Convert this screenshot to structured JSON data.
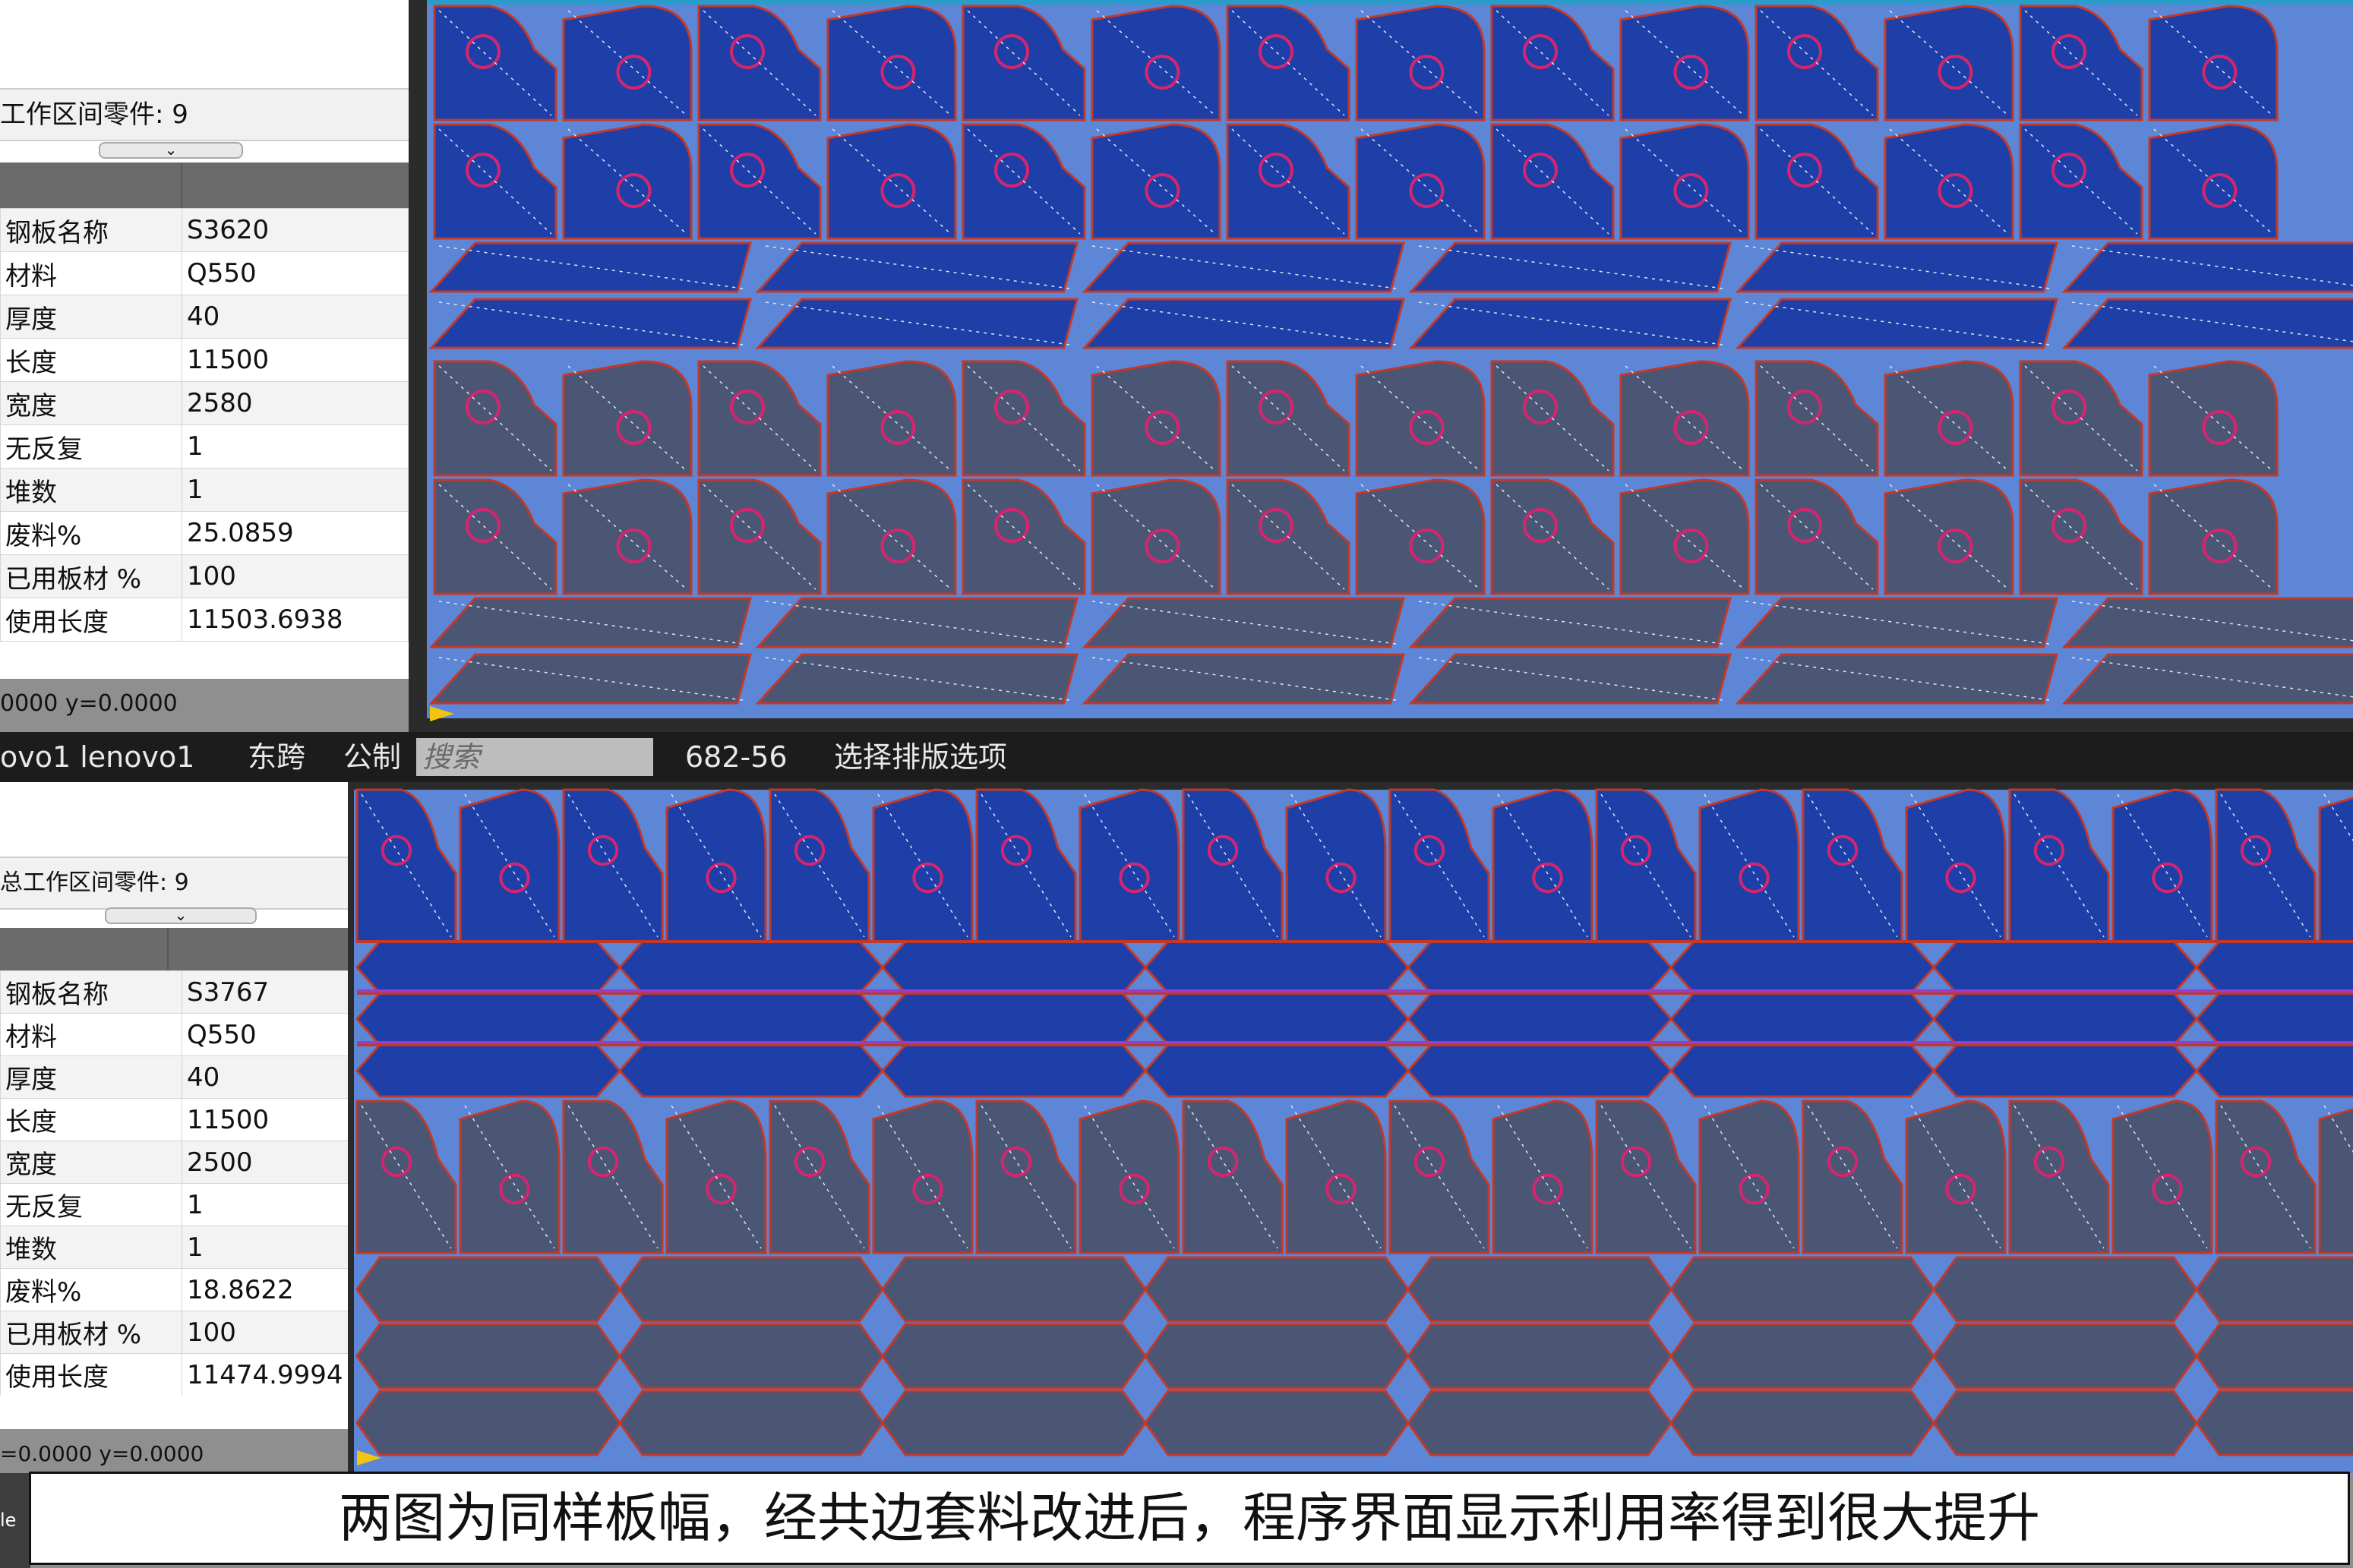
{
  "top": {
    "count_label": "工作区间零件: 9",
    "rows": [
      {
        "k": "钢板名称",
        "v": "S3620"
      },
      {
        "k": "材料",
        "v": "Q550"
      },
      {
        "k": "厚度",
        "v": "40"
      },
      {
        "k": "长度",
        "v": "11500"
      },
      {
        "k": "宽度",
        "v": "2580"
      },
      {
        "k": "无反复",
        "v": "1"
      },
      {
        "k": "堆数",
        "v": "1"
      },
      {
        "k": "废料%",
        "v": "25.0859"
      },
      {
        "k": "已用板材 %",
        "v": "100"
      },
      {
        "k": "使用长度",
        "v": "11503.6938"
      }
    ],
    "coords": "0000 y=0.0000"
  },
  "status": {
    "user": "ovo1 lenovo1",
    "timezone": "东跨",
    "units": "公制",
    "search_placeholder": "搜索",
    "code": "682-56",
    "nest_option": "选择排版选项"
  },
  "bottom": {
    "count_label": "总工作区间零件: 9",
    "rows": [
      {
        "k": "钢板名称",
        "v": "S3767"
      },
      {
        "k": "材料",
        "v": "Q550"
      },
      {
        "k": "厚度",
        "v": "40"
      },
      {
        "k": "长度",
        "v": "11500"
      },
      {
        "k": "宽度",
        "v": "2500"
      },
      {
        "k": "无反复",
        "v": "1"
      },
      {
        "k": "堆数",
        "v": "1"
      },
      {
        "k": "废料%",
        "v": "18.8622"
      },
      {
        "k": "已用板材 %",
        "v": "100"
      },
      {
        "k": "使用长度",
        "v": "11474.9994"
      }
    ],
    "coords": "=0.0000 y=0.0000",
    "taskbar_text": "le"
  },
  "caption": "两图为同样板幅，经共边套料改进后，程序界面显示利用率得到很大提升",
  "colors": {
    "sheet_bg": "#5e86d6",
    "part_selected": "#1e3fa8",
    "part_unselected": "#4b5675",
    "cut_line": "#c0392b",
    "hole_outline": "#d6246e",
    "bridge_line": "#9b3cc9"
  }
}
